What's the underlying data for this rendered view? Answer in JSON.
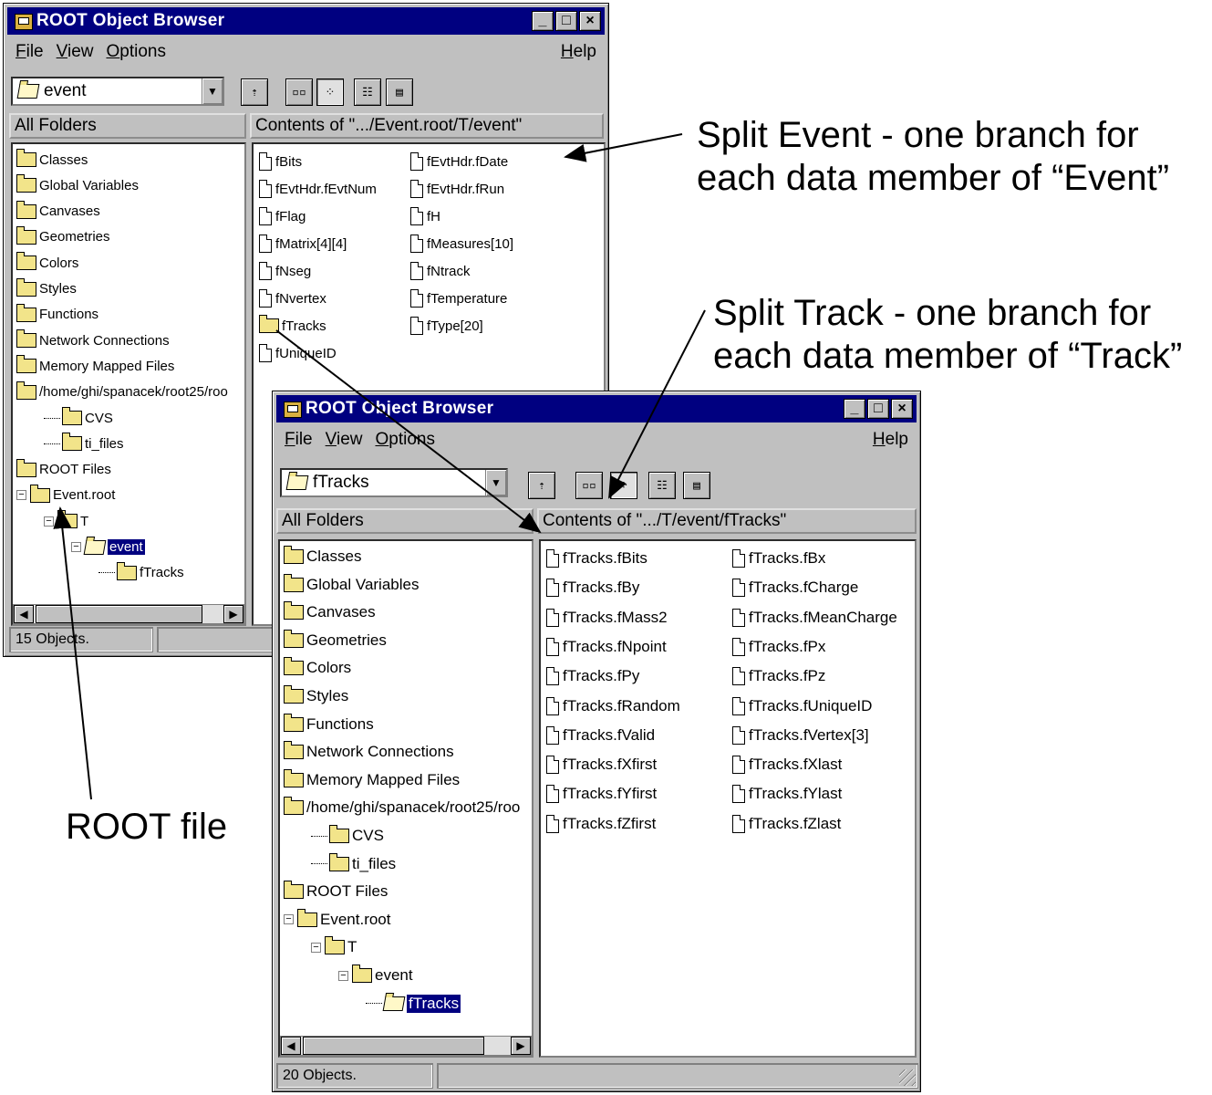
{
  "window_back": {
    "title": "ROOT Object Browser",
    "menu": [
      "File",
      "View",
      "Options"
    ],
    "help": "Help",
    "combo_value": "event",
    "all_folders_header": "All Folders",
    "contents_header": "Contents of \".../Event.root/T/event\"",
    "tree": [
      "Classes",
      "Global Variables",
      "Canvases",
      "Geometries",
      "Colors",
      "Styles",
      "Functions",
      "Network Connections",
      "Memory Mapped Files",
      "/home/ghi/spanacek/root25/roo",
      "CVS",
      "ti_files",
      "ROOT Files",
      "Event.root",
      "T",
      "event",
      "fTracks"
    ],
    "contents": [
      "fBits",
      "fEvtHdr.fDate",
      "fEvtHdr.fEvtNum",
      "fEvtHdr.fRun",
      "fFlag",
      "fH",
      "fMatrix[4][4]",
      "fMeasures[10]",
      "fNseg",
      "fNtrack",
      "fNvertex",
      "fTemperature",
      "fTracks",
      "fType[20]",
      "fUniqueID"
    ],
    "status": "15 Objects."
  },
  "window_front": {
    "title": "ROOT Object Browser",
    "menu": [
      "File",
      "View",
      "Options"
    ],
    "help": "Help",
    "combo_value": "fTracks",
    "all_folders_header": "All Folders",
    "contents_header": "Contents of \".../T/event/fTracks\"",
    "tree": [
      "Classes",
      "Global Variables",
      "Canvases",
      "Geometries",
      "Colors",
      "Styles",
      "Functions",
      "Network Connections",
      "Memory Mapped Files",
      "/home/ghi/spanacek/root25/roo",
      "CVS",
      "ti_files",
      "ROOT Files",
      "Event.root",
      "T",
      "event",
      "fTracks"
    ],
    "contents": [
      "fTracks.fBits",
      "fTracks.fBx",
      "fTracks.fBy",
      "fTracks.fCharge",
      "fTracks.fMass2",
      "fTracks.fMeanCharge",
      "fTracks.fNpoint",
      "fTracks.fPx",
      "fTracks.fPy",
      "fTracks.fPz",
      "fTracks.fRandom",
      "fTracks.fUniqueID",
      "fTracks.fValid",
      "fTracks.fVertex[3]",
      "fTracks.fXfirst",
      "fTracks.fXlast",
      "fTracks.fYfirst",
      "fTracks.fYlast",
      "fTracks.fZfirst",
      "fTracks.fZlast"
    ],
    "status": "20 Objects."
  },
  "annotations": {
    "split_event": "Split Event - one branch for\neach data member of “Event”",
    "split_track": "Split Track - one branch for\neach data member of “Track”",
    "root_file": "ROOT file"
  },
  "icons": {
    "folder": "folder-icon",
    "file": "file-icon",
    "tools": [
      "up-folder-icon",
      "large-icons-view-icon",
      "small-icons-view-icon",
      "list-view-icon",
      "details-view-icon"
    ]
  }
}
